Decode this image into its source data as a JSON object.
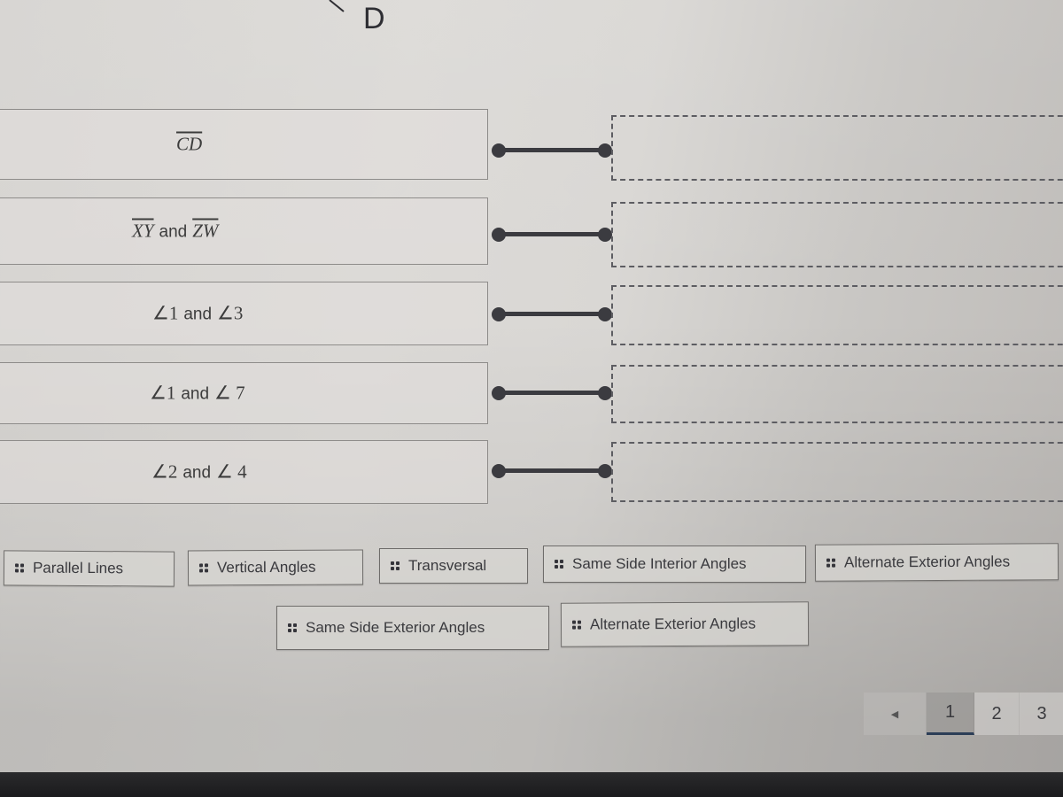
{
  "diagram": {
    "point_label": "D"
  },
  "matching": {
    "prompts": [
      {
        "id": "cd",
        "parts": [
          "CD"
        ],
        "type": "segment"
      },
      {
        "id": "xy-zw",
        "parts": [
          "XY",
          "and",
          "ZW"
        ],
        "type": "segment-pair"
      },
      {
        "id": "a1-a3",
        "parts": [
          "∠1",
          "and",
          "∠3"
        ],
        "type": "angle-pair"
      },
      {
        "id": "a1-a7",
        "parts": [
          "∠1",
          "and",
          "∠ 7"
        ],
        "type": "angle-pair"
      },
      {
        "id": "a2-a4",
        "parts": [
          "∠2",
          "and",
          "∠ 4"
        ],
        "type": "angle-pair"
      }
    ],
    "answers": [
      "",
      "",
      "",
      "",
      ""
    ]
  },
  "word_bank": {
    "chips": [
      {
        "label": "Parallel Lines",
        "icon": "drag-grip-icon"
      },
      {
        "label": "Vertical Angles",
        "icon": "drag-grip-icon"
      },
      {
        "label": "Transversal",
        "icon": "drag-grip-icon"
      },
      {
        "label": "Same Side Interior Angles",
        "icon": "drag-grip-icon"
      },
      {
        "label": "Alternate Exterior Angles",
        "icon": "drag-grip-icon"
      },
      {
        "label": "Same Side Exterior Angles",
        "icon": "drag-grip-icon"
      },
      {
        "label": "Alternate Exterior Angles",
        "icon": "drag-grip-icon"
      }
    ]
  },
  "pagination": {
    "prev_icon": "◀",
    "pages": [
      "1",
      "2",
      "3"
    ],
    "current": "1"
  },
  "colors": {
    "connector": "#3b3b40",
    "active_page_underline": "#2c3e57"
  }
}
